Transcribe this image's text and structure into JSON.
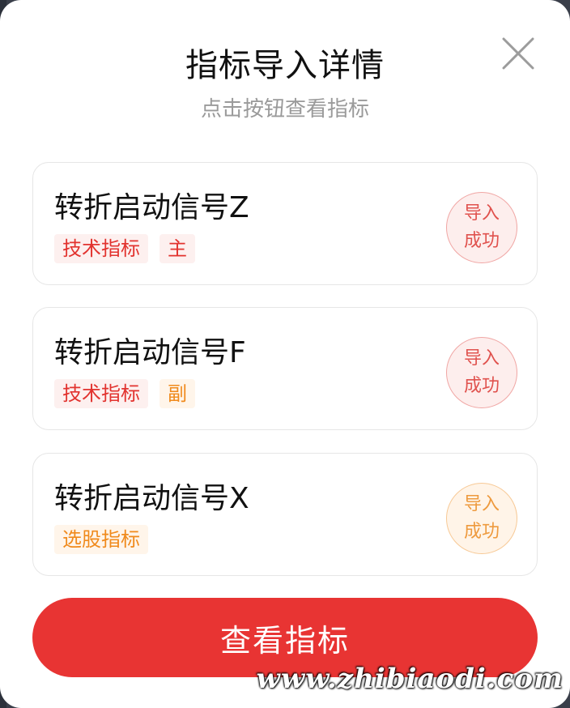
{
  "modal": {
    "title": "指标导入详情",
    "subtitle": "点击按钮查看指标"
  },
  "cards": [
    {
      "title": "转折启动信号Z",
      "tags": [
        {
          "label": "技术指标",
          "color": "red"
        },
        {
          "label": "主",
          "color": "red"
        }
      ],
      "status": {
        "line1": "导入",
        "line2": "成功",
        "color": "red"
      }
    },
    {
      "title": "转折启动信号F",
      "tags": [
        {
          "label": "技术指标",
          "color": "red"
        },
        {
          "label": "副",
          "color": "orange"
        }
      ],
      "status": {
        "line1": "导入",
        "line2": "成功",
        "color": "red"
      }
    },
    {
      "title": "转折启动信号X",
      "tags": [
        {
          "label": "选股指标",
          "color": "orange"
        }
      ],
      "status": {
        "line1": "导入",
        "line2": "成功",
        "color": "orange"
      }
    }
  ],
  "footer": {
    "button_label": "查看指标",
    "watermark": "www.zhibiaodi.com"
  },
  "colors": {
    "accent": "#e83433",
    "tag_red": "#e2332f",
    "tag_orange": "#f08a1c"
  },
  "icons": {
    "close": "close-icon"
  }
}
